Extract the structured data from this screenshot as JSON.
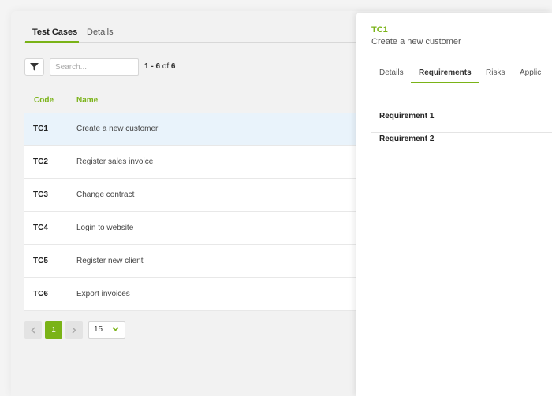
{
  "left_tabs": [
    {
      "label": "Test Cases",
      "active": true
    },
    {
      "label": "Details",
      "active": false
    }
  ],
  "toolbar": {
    "filter_icon": "filter-icon",
    "search_placeholder": "Search...",
    "count_range": "1 - 6",
    "count_of": "of",
    "count_total": "6"
  },
  "table": {
    "headers": {
      "code": "Code",
      "name": "Name"
    },
    "rows": [
      {
        "code": "TC1",
        "name": "Create a new customer",
        "selected": true
      },
      {
        "code": "TC2",
        "name": "Register sales invoice",
        "selected": false
      },
      {
        "code": "TC3",
        "name": "Change contract",
        "selected": false
      },
      {
        "code": "TC4",
        "name": "Login to website",
        "selected": false
      },
      {
        "code": "TC5",
        "name": "Register new client",
        "selected": false
      },
      {
        "code": "TC6",
        "name": "Export invoices",
        "selected": false
      }
    ]
  },
  "pagination": {
    "current_page": "1",
    "page_size": "15",
    "prev_icon": "chevron-left-icon",
    "next_icon": "chevron-right-icon"
  },
  "panel": {
    "code": "TC1",
    "title": "Create a new customer",
    "tabs": [
      {
        "label": "Details",
        "active": false
      },
      {
        "label": "Requirements",
        "active": true
      },
      {
        "label": "Risks",
        "active": false
      },
      {
        "label": "Applic",
        "active": false
      }
    ],
    "requirements": [
      "Requirement 1",
      "Requirement 2"
    ]
  },
  "colors": {
    "accent": "#7ab317",
    "selected_row": "#e9f3fb"
  }
}
